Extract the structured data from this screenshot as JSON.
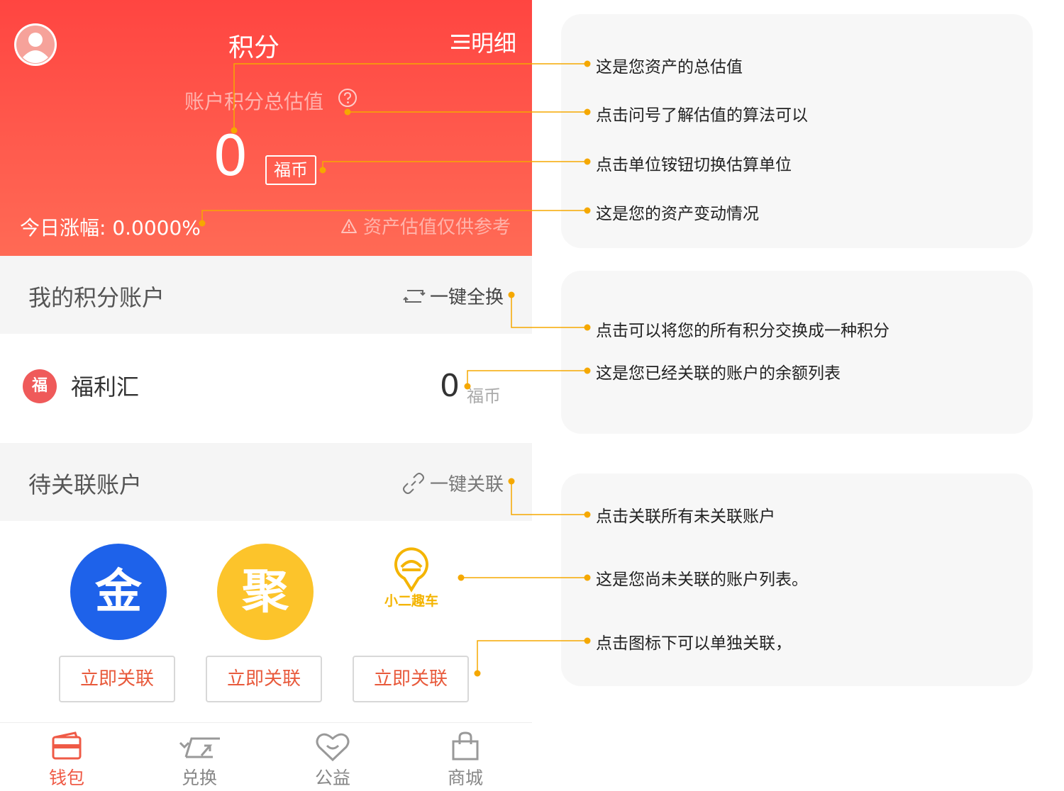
{
  "header": {
    "title": "积分",
    "detail_label": "明细",
    "estimate_label": "账户积分总估值",
    "total_value": "0",
    "unit_label": "福币",
    "today_change": "今日涨幅: 0.0000%",
    "disclaimer": "资产估值仅供参考"
  },
  "my_accounts": {
    "title": "我的积分账户",
    "action_label": "一键全换",
    "items": [
      {
        "logo_char": "福",
        "name": "福利汇",
        "balance": "0",
        "unit": "福币"
      }
    ]
  },
  "pending_accounts": {
    "title": "待关联账户",
    "action_label": "一键关联",
    "items": [
      {
        "logo_char": "金",
        "color": "#1e62ea",
        "button_label": "立即关联"
      },
      {
        "logo_char": "聚",
        "color": "#fcc42b",
        "button_label": "立即关联"
      },
      {
        "logo_text": "小二趣车",
        "color": "#f4b400",
        "button_label": "立即关联"
      }
    ]
  },
  "tabbar": {
    "items": [
      {
        "label": "钱包",
        "icon": "wallet-icon",
        "active": true
      },
      {
        "label": "兑换",
        "icon": "exchange-icon",
        "active": false
      },
      {
        "label": "公益",
        "icon": "heart-icon",
        "active": false
      },
      {
        "label": "商城",
        "icon": "shopping-bag-icon",
        "active": false
      }
    ]
  },
  "annotations": [
    "这是您资产的总估值",
    "点击问号了解估值的算法可以",
    "点击单位铵钮切换估算单位",
    "这是您的资产变动情况",
    "点击可以将您的所有积分交换成一种积分",
    "这是您已经关联的账户的余额列表",
    "点击关联所有未关联账户",
    "这是您尚未关联的账户列表。",
    "点击图标下可以单独关联，"
  ],
  "colors": {
    "header_red": "#ff4541",
    "accent_red": "#ef5a46",
    "annotation_line": "#f5a800",
    "card_bg": "#f7f7f7"
  }
}
